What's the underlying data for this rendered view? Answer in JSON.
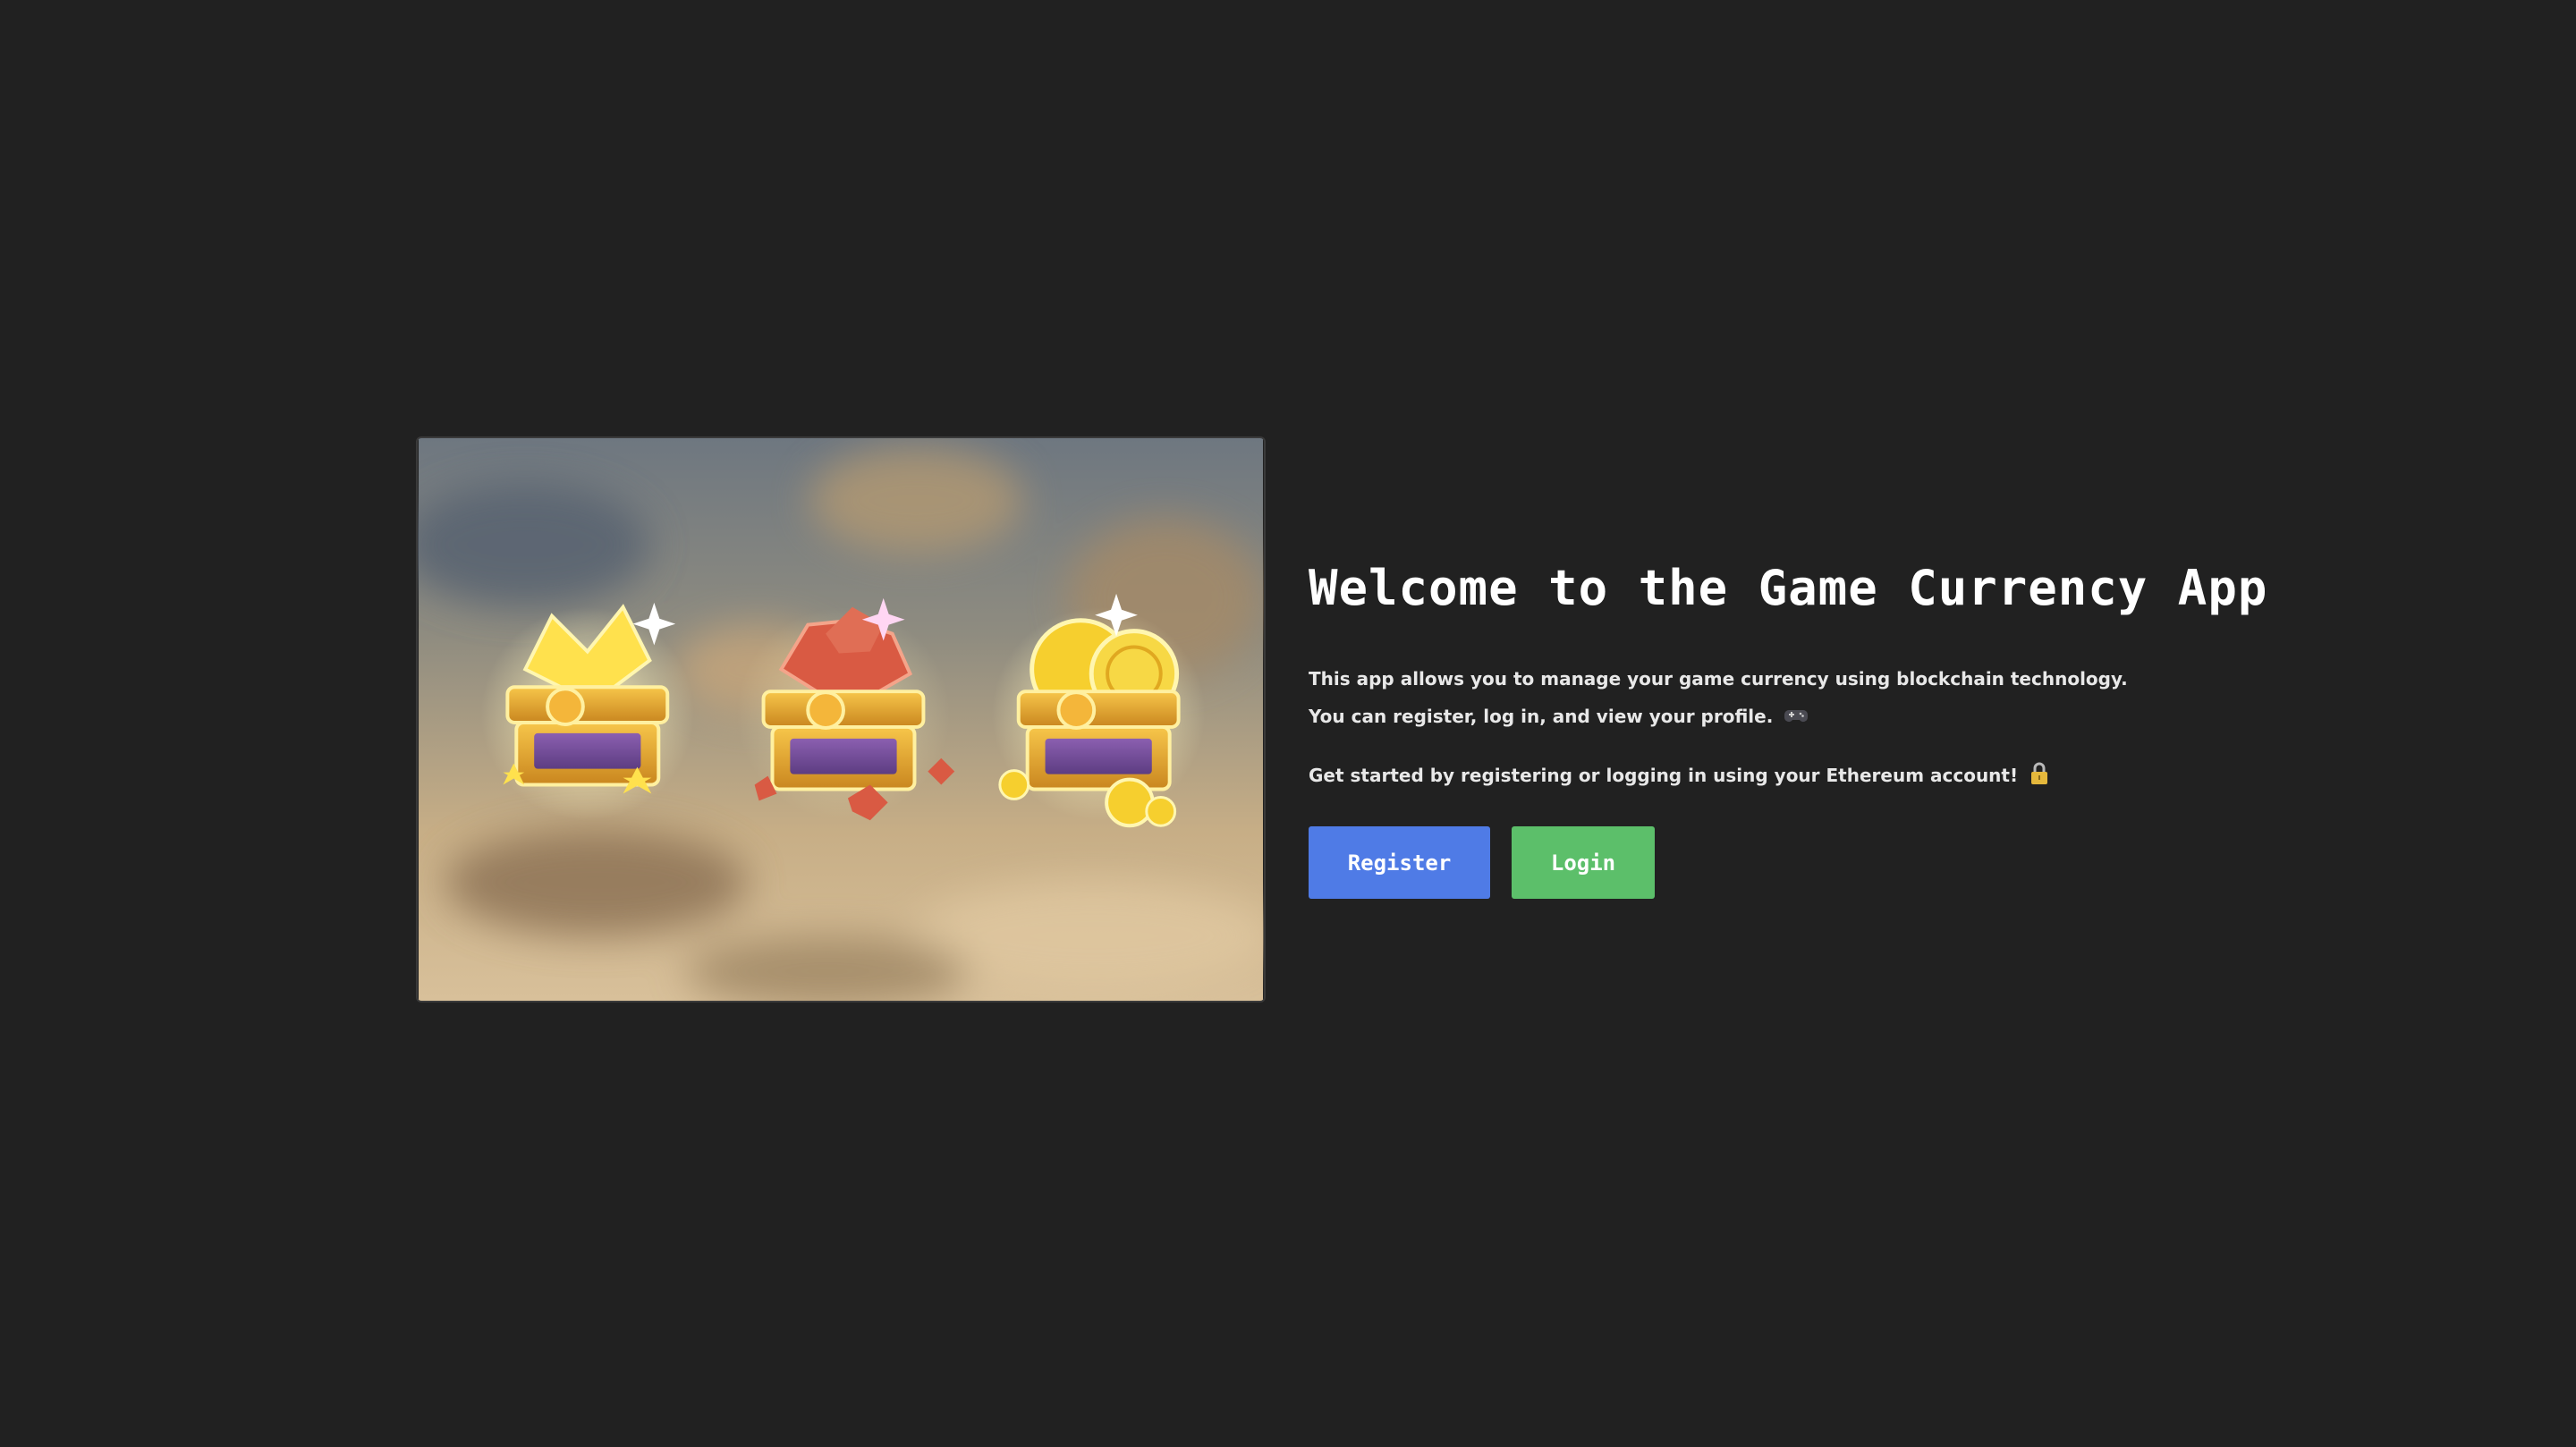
{
  "hero": {
    "image_alt": "Three treasure chests filled with gold stars, red gems and gold coins"
  },
  "main": {
    "title": "Welcome to the Game Currency App",
    "description": "This app allows you to manage your game currency using blockchain technology. You can register, log in, and view your profile.",
    "cta_text": "Get started by registering or logging in using your Ethereum account!",
    "description_icon": "game-controller-icon",
    "cta_icon": "lock-icon"
  },
  "buttons": {
    "register_label": "Register",
    "login_label": "Login"
  },
  "colors": {
    "background": "#212121",
    "register": "#4f7be6",
    "login": "#5cbf6a"
  }
}
